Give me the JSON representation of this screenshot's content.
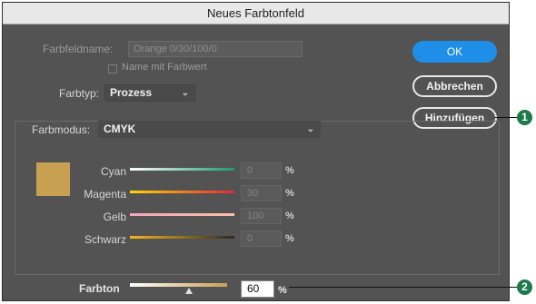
{
  "dialog": {
    "title": "Neues Farbtonfeld",
    "swatch_name_label": "Farbfeldname:",
    "swatch_name_value": "Orange 0/30/100/0",
    "name_with_value_label": "Name mit Farbwert",
    "color_type_label": "Farbtyp:",
    "color_type_value": "Prozess",
    "color_mode_label": "Farbmodus:",
    "color_mode_value": "CMYK",
    "swatch_color": "#c8a052",
    "ok_label": "OK",
    "cancel_label": "Abbrechen",
    "add_label": "Hinzufügen",
    "channels": [
      {
        "label": "Cyan",
        "value": "0",
        "unit": "%"
      },
      {
        "label": "Magenta",
        "value": "30",
        "unit": "%"
      },
      {
        "label": "Gelb",
        "value": "100",
        "unit": "%"
      },
      {
        "label": "Schwarz",
        "value": "0",
        "unit": "%"
      }
    ],
    "tint_label": "Farbton",
    "tint_value": "60",
    "tint_unit": "%"
  },
  "callouts": [
    "1",
    "2"
  ],
  "colors": {
    "accent": "#1f8ee8",
    "callout": "#1f7a4a"
  }
}
